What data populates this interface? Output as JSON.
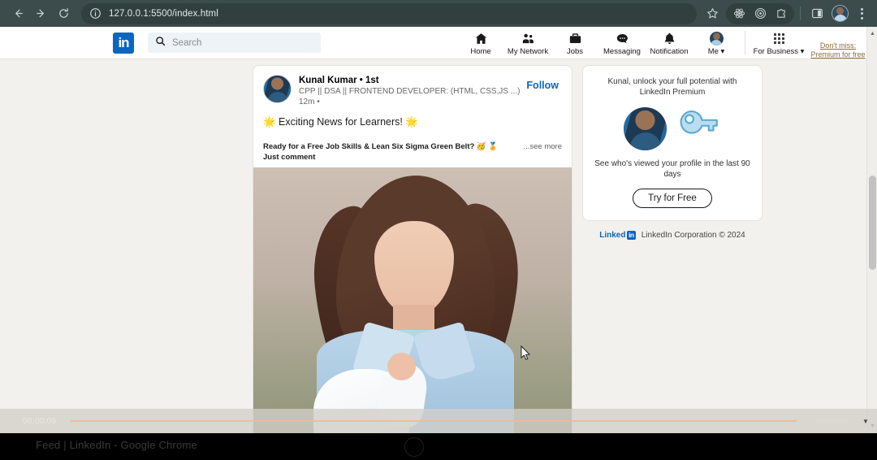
{
  "browser": {
    "back_icon": "back-arrow-icon",
    "forward_icon": "forward-arrow-icon",
    "reload_icon": "reload-icon",
    "site_info_icon": "site-info-icon",
    "url": "127.0.0.1:5500/index.html",
    "bookmark_icon": "star-icon",
    "extensions": [
      "atom-icon",
      "target-icon",
      "puzzle-icon"
    ],
    "side_panel_icon": "side-panel-icon",
    "profile_icon": "profile-avatar",
    "menu_icon": "kebab-menu-icon"
  },
  "linkedin_nav": {
    "logo_text": "in",
    "search_placeholder": "Search",
    "items": [
      {
        "label": "Home",
        "icon": "home-icon"
      },
      {
        "label": "My Network",
        "icon": "people-icon"
      },
      {
        "label": "Jobs",
        "icon": "briefcase-icon"
      },
      {
        "label": "Messaging",
        "icon": "message-icon"
      },
      {
        "label": "Notification",
        "icon": "bell-icon"
      },
      {
        "label": "Me ▾",
        "icon": "me-avatar-icon"
      }
    ],
    "for_business": "For Business ▾",
    "promo": "Don't miss: Premium for free"
  },
  "post": {
    "author_name": "Kunal Kumar • 1st",
    "author_headline": "CPP || DSA || FRONTEND DEVELOPER: (HTML, CSS,JS ...)",
    "timestamp": "12m •",
    "follow_label": "Follow",
    "headline": "🌟 Exciting News for Learners! 🌟",
    "body": "Ready for a Free Job Skills & Lean Six Sigma Green Belt? 🥳 🏅 Just comment",
    "see_more": "...see more",
    "image_alt": "post-photo"
  },
  "sidebar": {
    "headline": "Kunal, unlock your full potential with LinkedIn Premium",
    "description": "See who's viewed your profile in the last 90 days",
    "cta_label": "Try for Free",
    "footer_brand": "Linked",
    "footer_brand_box": "in",
    "footer_copy": "LinkedIn Corporation © 2024"
  },
  "recorder": {
    "elapsed": "00:00:09",
    "elapsed_right": "00:00:09"
  },
  "taskbar": {
    "window_title": "Feed | LinkedIn - Google Chrome"
  },
  "colors": {
    "chrome_bar": "#3c4c4c",
    "page_bg": "#f3f1ed",
    "linkedin_blue": "#0a66c2",
    "promo_gold": "#8a6d3b",
    "card_border": "#e3e2e0"
  }
}
